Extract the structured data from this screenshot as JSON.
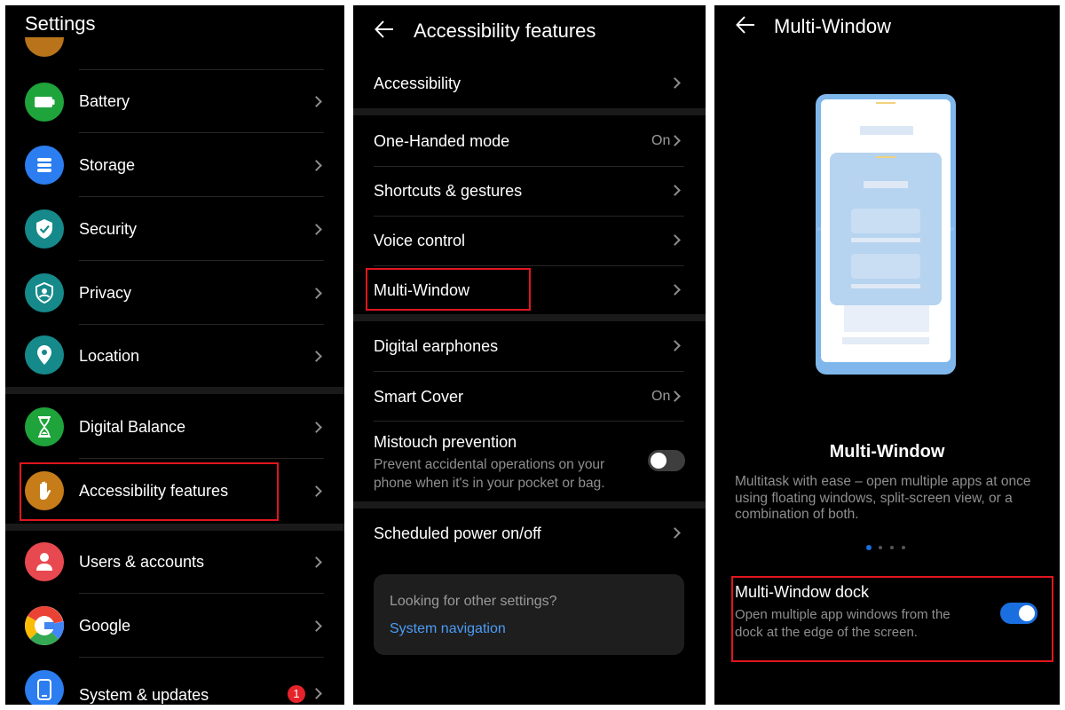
{
  "settings": {
    "title": "Settings",
    "items": [
      {
        "label": "Battery",
        "color": "#1fa33b",
        "icon": "battery-icon"
      },
      {
        "label": "Storage",
        "color": "#2b7df0",
        "icon": "storage-icon"
      },
      {
        "label": "Security",
        "color": "#16898a",
        "icon": "shield-icon"
      },
      {
        "label": "Privacy",
        "color": "#16898a",
        "icon": "privacy-shield-icon"
      },
      {
        "label": "Location",
        "color": "#16898a",
        "icon": "location-pin-icon"
      },
      {
        "label": "Digital Balance",
        "color": "#1fa33b",
        "icon": "hourglass-icon"
      },
      {
        "label": "Accessibility features",
        "color": "#c77c1a",
        "icon": "hand-icon"
      },
      {
        "label": "Users & accounts",
        "color": "#e8484f",
        "icon": "user-icon"
      },
      {
        "label": "Google",
        "color": "#ffffff",
        "icon": "google-icon"
      },
      {
        "label": "System & updates",
        "color": "#2b7df0",
        "icon": "phone-icon",
        "badge": "1"
      }
    ]
  },
  "accessibility": {
    "title": "Accessibility features",
    "items": [
      {
        "label": "Accessibility"
      },
      {
        "label": "One-Handed mode",
        "value": "On"
      },
      {
        "label": "Shortcuts & gestures"
      },
      {
        "label": "Voice control"
      },
      {
        "label": "Multi-Window"
      },
      {
        "label": "Digital earphones"
      },
      {
        "label": "Smart Cover",
        "value": "On"
      },
      {
        "label": "Mistouch prevention",
        "subtitle": "Prevent accidental operations on your phone when it's in your pocket or bag.",
        "toggle": false
      },
      {
        "label": "Scheduled power on/off"
      }
    ],
    "card": {
      "prompt": "Looking for other settings?",
      "link": "System navigation",
      "link_color": "#4b9cf5"
    }
  },
  "multiwindow": {
    "title": "Multi-Window",
    "heading": "Multi-Window",
    "description": "Multitask with ease – open multiple apps at once using floating windows, split-screen view, or a combination of both.",
    "dock": {
      "label": "Multi-Window dock",
      "subtitle": "Open multiple app windows from the dock at the edge of the screen.",
      "toggle": true
    },
    "accent": "#1a6fe0"
  }
}
